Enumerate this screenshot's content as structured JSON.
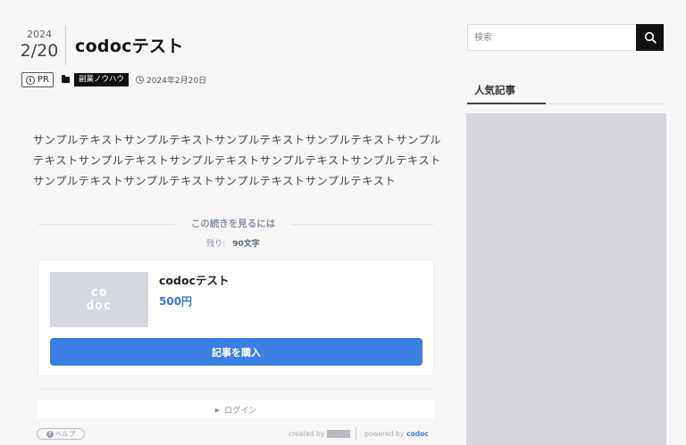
{
  "post": {
    "year": "2024",
    "month_day": "2/20",
    "title": "codocテスト",
    "pr_label": "PR",
    "category": "副業ノウハウ",
    "date": "2024年2月20日",
    "body": "サンプルテキストサンプルテキストサンプルテキストサンプルテキストサンプルテキストサンプルテキストサンプルテキストサンプルテキストサンプルテキストサンプルテキストサンプルテキストサンプルテキストサンプルテキスト"
  },
  "paywall": {
    "heading": "この続きを見るには",
    "remaining_label": "残り:",
    "remaining_count": "90文字",
    "product_title": "codocテスト",
    "price": "500円",
    "thumb_logo": "co\ndoc",
    "buy_label": "記事を購入",
    "login_label": "ログイン",
    "help_label": "ヘルプ",
    "created_by": "created by",
    "powered_by": "powered by",
    "powered_brand": "codoc",
    "accent_color": "#3b7fe3"
  },
  "sidebar": {
    "search_placeholder": "検索",
    "popular_heading": "人気記事"
  },
  "icons": {
    "info": "info-icon",
    "folder": "folder-icon",
    "clock": "clock-icon",
    "search": "search-icon",
    "caret": "caret-right-icon",
    "help": "question-icon"
  }
}
